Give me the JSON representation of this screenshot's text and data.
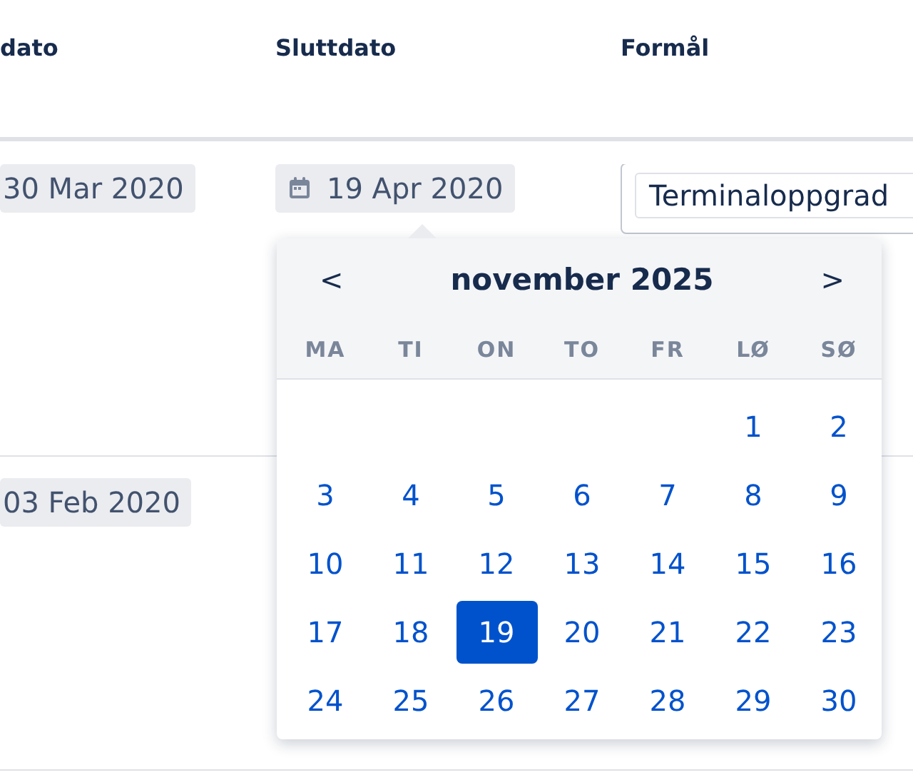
{
  "table": {
    "columns": [
      "dato",
      "Sluttdato",
      "Formål"
    ],
    "rows": [
      {
        "start": "30 Mar 2020",
        "end": "19 Apr 2020",
        "purpose": "Terminaloppgrad"
      },
      {
        "start": "03 Feb 2020"
      }
    ]
  },
  "datepicker": {
    "prev": "<",
    "next": ">",
    "title": "november 2025",
    "weekdays": [
      "MA",
      "TI",
      "ON",
      "TO",
      "FR",
      "LØ",
      "SØ"
    ],
    "weeks": [
      {
        "kind": "leading",
        "days": [
          {
            "label": "1",
            "selected": false
          },
          {
            "label": "2",
            "selected": false
          }
        ]
      },
      {
        "kind": "full",
        "days": [
          {
            "label": "3",
            "selected": false
          },
          {
            "label": "4",
            "selected": false
          },
          {
            "label": "5",
            "selected": false
          },
          {
            "label": "6",
            "selected": false
          },
          {
            "label": "7",
            "selected": false
          },
          {
            "label": "8",
            "selected": false
          },
          {
            "label": "9",
            "selected": false
          }
        ]
      },
      {
        "kind": "full",
        "days": [
          {
            "label": "10",
            "selected": false
          },
          {
            "label": "11",
            "selected": false
          },
          {
            "label": "12",
            "selected": false
          },
          {
            "label": "13",
            "selected": false
          },
          {
            "label": "14",
            "selected": false
          },
          {
            "label": "15",
            "selected": false
          },
          {
            "label": "16",
            "selected": false
          }
        ]
      },
      {
        "kind": "full",
        "days": [
          {
            "label": "17",
            "selected": false
          },
          {
            "label": "18",
            "selected": false
          },
          {
            "label": "19",
            "selected": true
          },
          {
            "label": "20",
            "selected": false
          },
          {
            "label": "21",
            "selected": false
          },
          {
            "label": "22",
            "selected": false
          },
          {
            "label": "23",
            "selected": false
          }
        ]
      },
      {
        "kind": "full",
        "days": [
          {
            "label": "24",
            "selected": false
          },
          {
            "label": "25",
            "selected": false
          },
          {
            "label": "26",
            "selected": false
          },
          {
            "label": "27",
            "selected": false
          },
          {
            "label": "28",
            "selected": false
          },
          {
            "label": "29",
            "selected": false
          },
          {
            "label": "30",
            "selected": false
          }
        ]
      }
    ]
  }
}
